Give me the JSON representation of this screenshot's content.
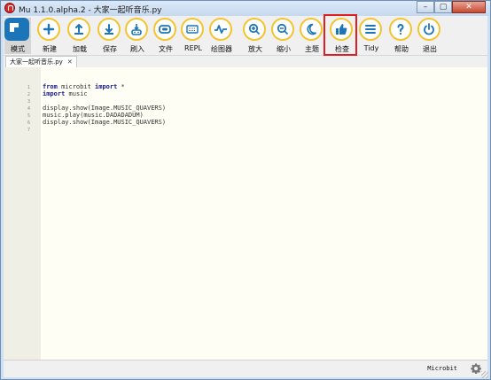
{
  "window": {
    "title": "Mu 1.1.0.alpha.2 - 大家一起听音乐.py"
  },
  "toolbar": {
    "buttons": [
      {
        "id": "mode",
        "label": "模式",
        "icon": "mode-icon"
      },
      {
        "id": "new",
        "label": "新建",
        "icon": "plus-icon"
      },
      {
        "id": "load",
        "label": "加载",
        "icon": "upload-icon"
      },
      {
        "id": "save",
        "label": "保存",
        "icon": "download-icon"
      },
      {
        "id": "flash",
        "label": "刷入",
        "icon": "flash-icon"
      },
      {
        "id": "files",
        "label": "文件",
        "icon": "files-icon"
      },
      {
        "id": "repl",
        "label": "REPL",
        "icon": "keyboard-icon"
      },
      {
        "id": "plotter",
        "label": "绘图器",
        "icon": "plotter-icon"
      },
      {
        "id": "zoom-in",
        "label": "放大",
        "icon": "zoom-in-icon"
      },
      {
        "id": "zoom-out",
        "label": "缩小",
        "icon": "zoom-out-icon"
      },
      {
        "id": "theme",
        "label": "主题",
        "icon": "moon-icon"
      },
      {
        "id": "check",
        "label": "检查",
        "icon": "thumbs-up-icon"
      },
      {
        "id": "tidy",
        "label": "Tidy",
        "icon": "tidy-icon"
      },
      {
        "id": "help",
        "label": "帮助",
        "icon": "help-icon"
      },
      {
        "id": "quit",
        "label": "退出",
        "icon": "power-icon"
      }
    ],
    "accent": "#f4c430",
    "icon_color": "#1d75b9",
    "highlight_color": "#e02020"
  },
  "tabs": [
    {
      "label": "大家一起听音乐.py",
      "close": "✕"
    }
  ],
  "editor": {
    "line_numbers": [
      "1",
      "2",
      "3",
      "4",
      "5",
      "6",
      "7"
    ],
    "lines": [
      {
        "parts": [
          {
            "t": "from",
            "kw": true
          },
          {
            "t": " microbit "
          },
          {
            "t": "import",
            "kw": true
          },
          {
            "t": " *"
          }
        ]
      },
      {
        "parts": [
          {
            "t": "import",
            "kw": true
          },
          {
            "t": " music"
          }
        ]
      },
      {
        "parts": [
          {
            "t": ""
          }
        ]
      },
      {
        "parts": [
          {
            "t": "display.show(Image.MUSIC_QUAVERS)"
          }
        ]
      },
      {
        "parts": [
          {
            "t": "music.play(music.DADADADUM)"
          }
        ]
      },
      {
        "parts": [
          {
            "t": "display.show(Image.MUSIC_QUAVERS)"
          }
        ]
      },
      {
        "parts": [
          {
            "t": ""
          }
        ]
      }
    ]
  },
  "status": {
    "mode": "Microbit",
    "settings_icon": "gear-icon"
  }
}
